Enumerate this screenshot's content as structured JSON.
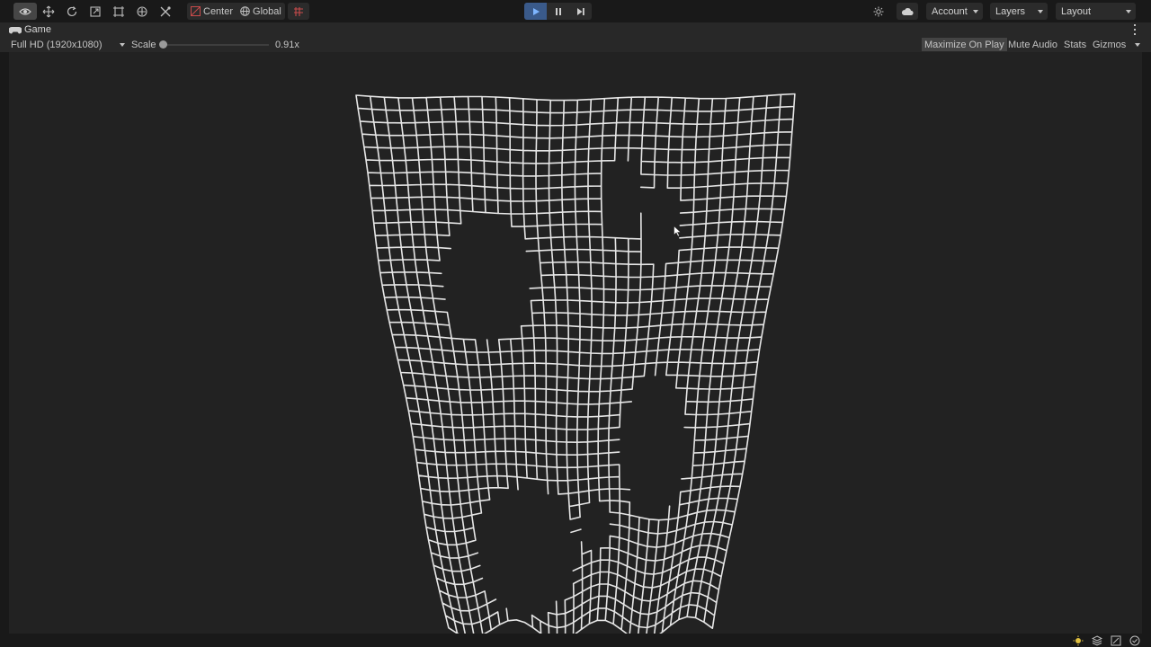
{
  "toolbar": {
    "tools": [
      {
        "icon": "view-tool-icon",
        "active": true
      },
      {
        "icon": "move-tool-icon"
      },
      {
        "icon": "rotate-tool-icon"
      },
      {
        "icon": "scale-tool-icon"
      },
      {
        "icon": "rect-tool-icon"
      },
      {
        "icon": "transform-tool-icon"
      },
      {
        "icon": "custom-tool-icon"
      }
    ],
    "pivot_label": "Center",
    "space_label": "Global",
    "account_label": "Account",
    "layers_label": "Layers",
    "layout_label": "Layout",
    "play_active": true
  },
  "game_tab": {
    "title": "Game",
    "resolution": "Full HD (1920x1080)",
    "scale_label": "Scale",
    "scale_value": "0.91x",
    "scale_level": 0.05,
    "maximize_label": "Maximize On Play",
    "mute_label": "Mute Audio",
    "stats_label": "Stats",
    "gizmos_label": "Gizmos"
  },
  "colors": {
    "background": "#191919",
    "panel": "#282828",
    "viewport": "#222222",
    "mesh": "#e6e6e6",
    "play_active": "#3a5a8a"
  }
}
